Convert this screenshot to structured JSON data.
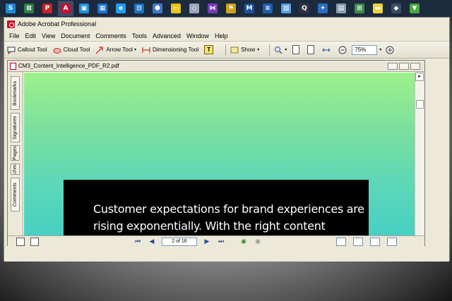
{
  "taskbar": {
    "icons": [
      {
        "name": "skype-icon",
        "color": "#1a8ad6",
        "glyph": "S"
      },
      {
        "name": "spreadsheet-icon",
        "color": "#2f7d45",
        "glyph": "⊠"
      },
      {
        "name": "pinterest-icon",
        "color": "#c9202a",
        "glyph": "P"
      },
      {
        "name": "acrobat-icon",
        "color": "#c8102e",
        "glyph": "A"
      },
      {
        "name": "photos-icon",
        "color": "#1f8fe0",
        "glyph": "▣"
      },
      {
        "name": "calendar-icon",
        "color": "#1a74d1",
        "glyph": "▦"
      },
      {
        "name": "edge-icon",
        "color": "#1d9ff0",
        "glyph": "e"
      },
      {
        "name": "store-icon",
        "color": "#1f70c1",
        "glyph": "⊡"
      },
      {
        "name": "shield-icon",
        "color": "#3c78c8",
        "glyph": "⬢"
      },
      {
        "name": "notes-icon",
        "color": "#e6c317",
        "glyph": "▭"
      },
      {
        "name": "cube-icon",
        "color": "#9ca6b5",
        "glyph": "◇"
      },
      {
        "name": "vs-icon",
        "color": "#7a3bb8",
        "glyph": "⋈"
      },
      {
        "name": "flag-icon",
        "color": "#d4a017",
        "glyph": "⚑"
      },
      {
        "name": "m-app-icon",
        "color": "#1c4f9c",
        "glyph": "M"
      },
      {
        "name": "list-icon",
        "color": "#1d5fb3",
        "glyph": "≡"
      },
      {
        "name": "photo-icon",
        "color": "#5aa0e0",
        "glyph": "▧"
      },
      {
        "name": "q-app-icon",
        "color": "#334",
        "glyph": "Q"
      },
      {
        "name": "star-app-icon",
        "color": "#2b6dc2",
        "glyph": "✦"
      },
      {
        "name": "calc-icon",
        "color": "#8f9db2",
        "glyph": "▤"
      },
      {
        "name": "sheet-icon",
        "color": "#3e8a4a",
        "glyph": "⊞"
      },
      {
        "name": "chat-icon",
        "color": "#f3d33b",
        "glyph": "▬"
      },
      {
        "name": "cloud-icon",
        "color": "#3a4c66",
        "glyph": "◆"
      },
      {
        "name": "vpn-icon",
        "color": "#44a83c",
        "glyph": "▼"
      }
    ]
  },
  "window": {
    "title": "Adobe Acrobat Professional"
  },
  "menu": [
    "File",
    "Edit",
    "View",
    "Document",
    "Comments",
    "Tools",
    "Advanced",
    "Window",
    "Help"
  ],
  "toolbar": {
    "callout": "Callout Tool",
    "cloud": "Cloud Tool",
    "arrow": "Arrow Tool",
    "dimensioning": "Dimensioning Tool",
    "show": "Show",
    "zoom": "75%"
  },
  "document": {
    "filename": "CM3_Content_Intelligence_PDF_R2.pdf",
    "side_tabs": [
      "Bookmarks",
      "Signatures",
      "Pages",
      "Attachments",
      "Comments"
    ],
    "text_line1": "Customer expectations for brand experiences are",
    "text_line2": "rising exponentially. With the right content",
    "page_indicator": "2 of 16"
  },
  "colors": {
    "page_gradient_top": "#9ef08a",
    "page_gradient_bottom": "#47cfc4",
    "title_bar": "#ece9d8"
  }
}
